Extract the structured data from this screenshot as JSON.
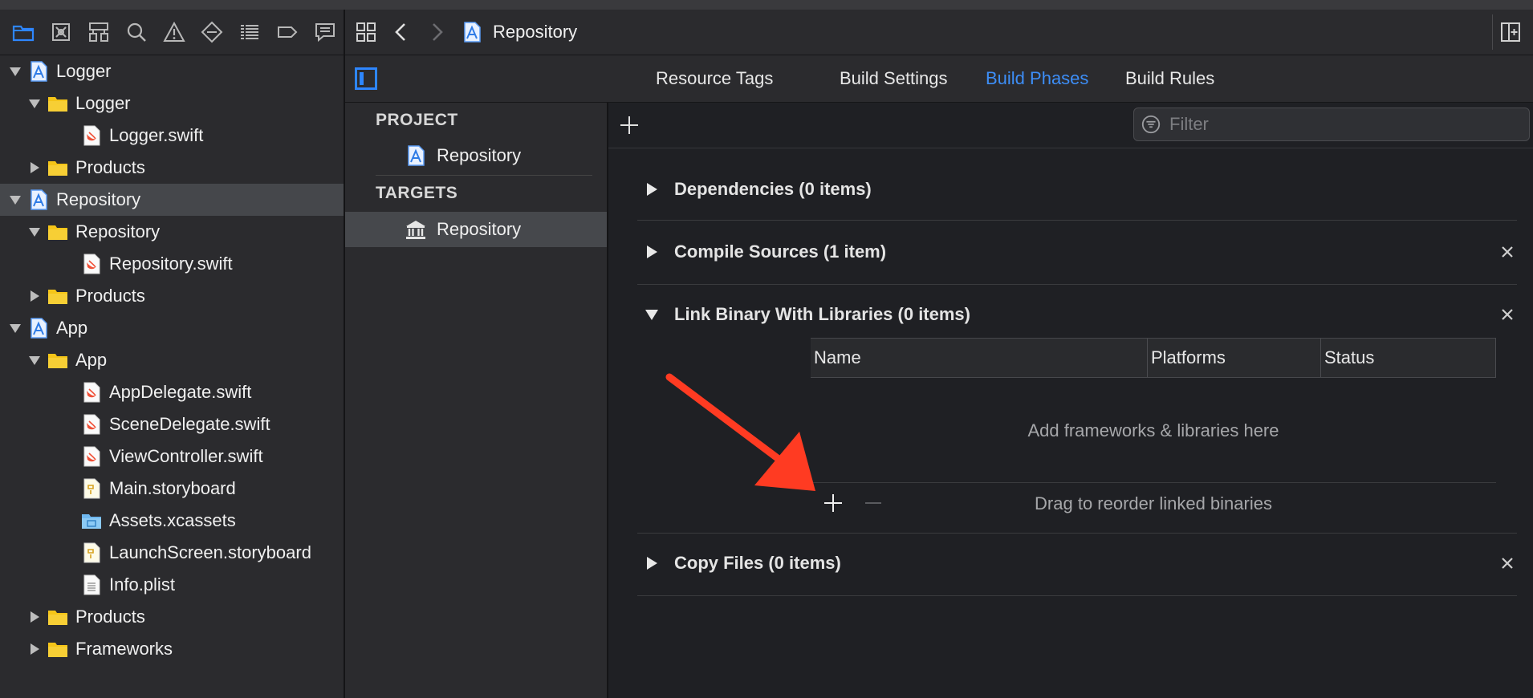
{
  "navigator": {
    "tabs": [
      {
        "icon": "folder-icon"
      },
      {
        "icon": "source-control-icon"
      },
      {
        "icon": "symbol-icon"
      },
      {
        "icon": "search-icon"
      },
      {
        "icon": "warning-icon"
      },
      {
        "icon": "test-icon"
      },
      {
        "icon": "debug-icon"
      },
      {
        "icon": "breakpoint-icon"
      },
      {
        "icon": "report-icon"
      }
    ],
    "tree": [
      {
        "label": "Logger",
        "kind": "project",
        "depth": 0,
        "expanded": true
      },
      {
        "label": "Logger",
        "kind": "folder",
        "depth": 1,
        "expanded": true
      },
      {
        "label": "Logger.swift",
        "kind": "swift",
        "depth": 2
      },
      {
        "label": "Products",
        "kind": "folder",
        "depth": 1,
        "expanded": false
      },
      {
        "label": "Repository",
        "kind": "project",
        "depth": 0,
        "expanded": true,
        "selected": true
      },
      {
        "label": "Repository",
        "kind": "folder",
        "depth": 1,
        "expanded": true
      },
      {
        "label": "Repository.swift",
        "kind": "swift",
        "depth": 2
      },
      {
        "label": "Products",
        "kind": "folder",
        "depth": 1,
        "expanded": false
      },
      {
        "label": "App",
        "kind": "project",
        "depth": 0,
        "expanded": true
      },
      {
        "label": "App",
        "kind": "folder",
        "depth": 1,
        "expanded": true
      },
      {
        "label": "AppDelegate.swift",
        "kind": "swift",
        "depth": 2
      },
      {
        "label": "SceneDelegate.swift",
        "kind": "swift",
        "depth": 2
      },
      {
        "label": "ViewController.swift",
        "kind": "swift",
        "depth": 2
      },
      {
        "label": "Main.storyboard",
        "kind": "storyboard",
        "depth": 2
      },
      {
        "label": "Assets.xcassets",
        "kind": "assets",
        "depth": 2
      },
      {
        "label": "LaunchScreen.storyboard",
        "kind": "storyboard",
        "depth": 2
      },
      {
        "label": "Info.plist",
        "kind": "plist",
        "depth": 2
      },
      {
        "label": "Products",
        "kind": "folder",
        "depth": 1,
        "expanded": false
      },
      {
        "label": "Frameworks",
        "kind": "folder",
        "depth": 1,
        "expanded": false
      }
    ]
  },
  "toolbar": {
    "breadcrumb": "Repository"
  },
  "tabs": [
    {
      "label": "Resource Tags",
      "active": false
    },
    {
      "label": "Build Settings",
      "active": false
    },
    {
      "label": "Build Phases",
      "active": true
    },
    {
      "label": "Build Rules",
      "active": false
    }
  ],
  "targets_panel": {
    "project_header": "PROJECT",
    "project_item": "Repository",
    "targets_header": "TARGETS",
    "target_item": "Repository"
  },
  "content": {
    "filter_placeholder": "Filter",
    "phases": [
      {
        "title": "Dependencies (0 items)",
        "expanded": false,
        "closable": false
      },
      {
        "title": "Compile Sources (1 item)",
        "expanded": false,
        "closable": true
      },
      {
        "title": "Link Binary With Libraries (0 items)",
        "expanded": true,
        "closable": true
      },
      {
        "title": "Copy Files (0 items)",
        "expanded": false,
        "closable": true
      }
    ],
    "libraries": {
      "columns": [
        "Name",
        "Platforms",
        "Status"
      ],
      "empty_message": "Add frameworks & libraries here",
      "reorder_hint": "Drag to reorder linked binaries"
    }
  },
  "colors": {
    "accent": "#3d8ef7",
    "annotation_arrow": "#ff3b22",
    "folder": "#f5c518"
  }
}
